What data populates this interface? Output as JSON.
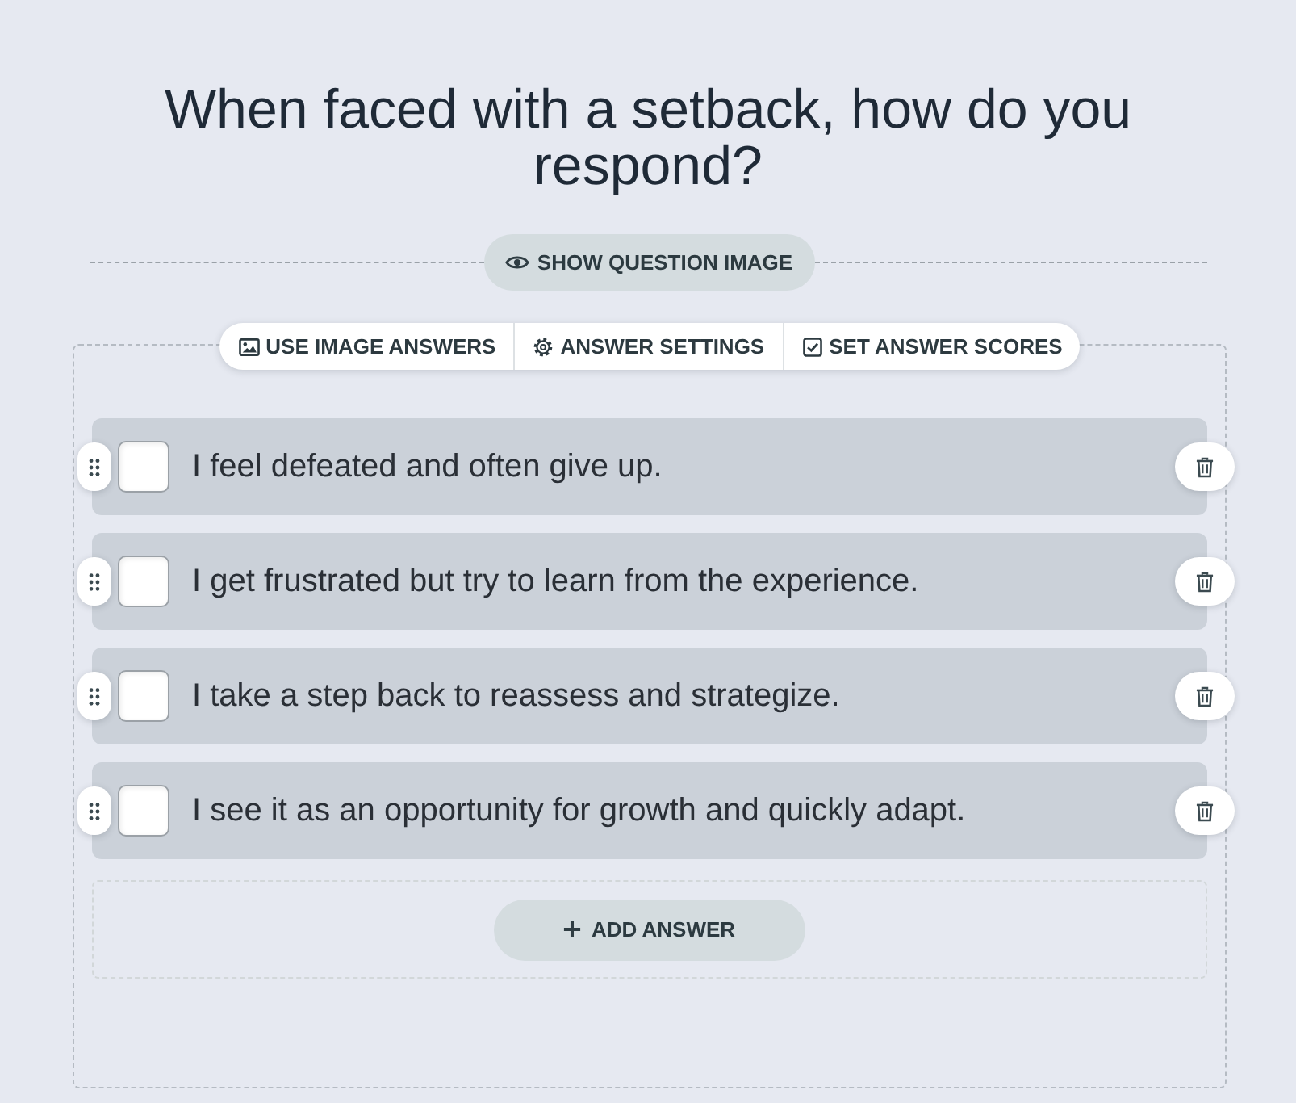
{
  "title": "When faced with a setback, how do you respond?",
  "question_image_button": {
    "label": "SHOW QUESTION IMAGE"
  },
  "toolbar": [
    {
      "kind": "image",
      "label": "USE IMAGE ANSWERS"
    },
    {
      "kind": "settings",
      "label": "ANSWER SETTINGS"
    },
    {
      "kind": "scores",
      "label": "SET ANSWER SCORES"
    }
  ],
  "answers": [
    {
      "text": "I feel defeated and often give up.",
      "checked": false
    },
    {
      "text": "I get frustrated but try to learn from the experience.",
      "checked": false
    },
    {
      "text": "I take a step back to reassess and strategize.",
      "checked": false
    },
    {
      "text": "I see it as an opportunity for growth and quickly adapt.",
      "checked": false
    }
  ],
  "add_answer_button": {
    "label": "ADD ANSWER"
  }
}
